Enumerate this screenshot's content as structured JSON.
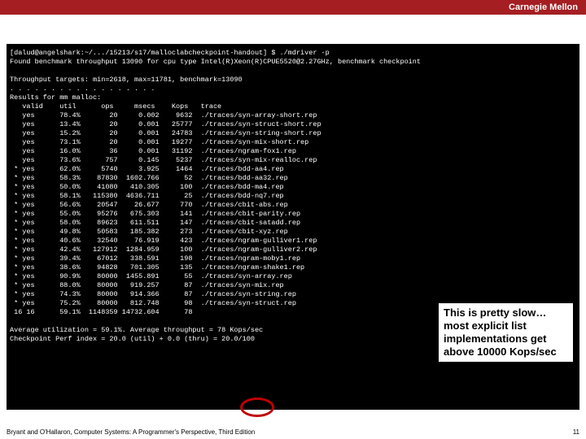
{
  "header": {
    "brand": "Carnegie Mellon"
  },
  "term": {
    "prompt": "[dalud@angelshark:~/.../15213/s17/malloclabcheckpoint-handout] $ ./mdriver -p",
    "found": "Found benchmark throughput 13090 for cpu type Intel(R)Xeon(R)CPUE5520@2.27GHz, benchmark checkpoint",
    "blank1": "",
    "targets": "Throughput targets: min=2618, max=11781, benchmark=13090",
    "dots": ". . . . . . . . . . . . . . . . . .",
    "results": "Results for mm malloc:",
    "hdr": "   valid    util      ops     msecs    Kops   trace",
    "r0": "   yes      78.4%       20     0.002    9632  ./traces/syn-array-short.rep",
    "r1": "   yes      13.4%       20     0.001   25777  ./traces/syn-struct-short.rep",
    "r2": "   yes      15.2%       20     0.001   24783  ./traces/syn-string-short.rep",
    "r3": "   yes      73.1%       20     0.001   19277  ./traces/syn-mix-short.rep",
    "r4": "   yes      16.0%       36     0.001   31192  ./traces/ngram-fox1.rep",
    "r5": "   yes      73.6%      757     0.145    5237  ./traces/syn-mix-realloc.rep",
    "r6": " * yes      62.0%     5740     3.925    1464  ./traces/bdd-aa4.rep",
    "r7": " * yes      58.3%    87830  1602.766      52  ./traces/bdd-aa32.rep",
    "r8": " * yes      50.0%    41080   410.305     100  ./traces/bdd-ma4.rep",
    "r9": " * yes      58.1%   115380  4636.711      25  ./traces/bdd-nq7.rep",
    "r10": " * yes      56.6%    20547    26.677     770  ./traces/cbit-abs.rep",
    "r11": " * yes      55.0%    95276   675.303     141  ./traces/cbit-parity.rep",
    "r12": " * yes      58.0%    89623   611.511     147  ./traces/cbit-satadd.rep",
    "r13": " * yes      49.8%    50583   185.382     273  ./traces/cbit-xyz.rep",
    "r14": " * yes      40.6%    32540    76.919     423  ./traces/ngram-gulliver1.rep",
    "r15": " * yes      42.4%   127912  1284.959     100  ./traces/ngram-gulliver2.rep",
    "r16": " * yes      39.4%    67012   338.591     198  ./traces/ngram-moby1.rep",
    "r17": " * yes      38.6%    94828   701.305     135  ./traces/ngram-shake1.rep",
    "r18": " * yes      90.9%    80000  1455.891      55  ./traces/syn-array.rep",
    "r19": " * yes      88.0%    80000   919.257      87  ./traces/syn-mix.rep",
    "r20": " * yes      74.3%    80000   914.366      87  ./traces/syn-string.rep",
    "r21": " * yes      75.2%    80000   812.748      98  ./traces/syn-struct.rep",
    "r22": " 16 16      59.1%  1148359 14732.604      78",
    "blank2": "",
    "avg": "Average utilization = 59.1%. Average throughput = 78 Kops/sec",
    "perf": "Checkpoint Perf index = 20.0 (util) + 0.0 (thru) = 20.0/100"
  },
  "callout": {
    "text": "This is pretty slow… most explicit list implementations get above 10000 Kops/sec"
  },
  "footer": {
    "left": "Bryant and O'Hallaron, Computer Systems: A Programmer's Perspective, Third Edition",
    "right": "11"
  }
}
